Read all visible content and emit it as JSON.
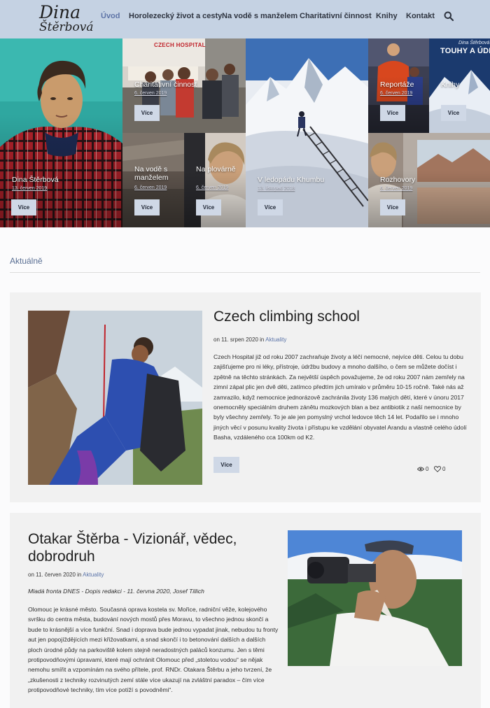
{
  "logo": {
    "line1": "Dina",
    "line2": "Štěrbová"
  },
  "nav": [
    {
      "label": "Úvod"
    },
    {
      "label": "Horolezecký život a cesty"
    },
    {
      "label": "Na vodě s manželem"
    },
    {
      "label": "Charitativní činnost"
    },
    {
      "label": "Knihy"
    },
    {
      "label": "Kontakt"
    }
  ],
  "tiles": [
    {
      "title": "Dina Štěrbová",
      "date": "13. červen 2019",
      "button": "Více"
    },
    {
      "title": "Charitativní činnost",
      "date": "6. červen 2019",
      "button": "Více"
    },
    {
      "title": "Na vodě s manželem",
      "date": "6. červen 2019",
      "button": "Více"
    },
    {
      "title": "Na plovárně",
      "date": "6. červen 2019",
      "button": "Více"
    },
    {
      "title": "V ledopádu Khumbu",
      "date": "13. listopad 2018",
      "button": "Více"
    },
    {
      "title": "Reportáže",
      "date": "6. červen 2019",
      "button": "Více"
    },
    {
      "title": "Knihy",
      "date": "",
      "button": "Více"
    },
    {
      "title": "Rozhovory",
      "date": "6. červen 2019",
      "button": "Více"
    }
  ],
  "book_cover": {
    "author": "Dina Štěrbová",
    "title": "TOUHY A ÚDĚL"
  },
  "hospital_sign": "CZECH HOSPITAL",
  "section_title": "Aktuálně",
  "posts": [
    {
      "title": "Czech climbing school",
      "meta_prefix": "on 11. srpen 2020 in",
      "category": "Aktuality",
      "text": "Czech Hospital již od roku 2007 zachraňuje životy a léčí nemocné, nejvíce děti. Celou tu dobu zajišťujeme pro ni léky, přístroje, údržbu budovy a mnoho dalšího, o čem se můžete dočíst i zpětně na těchto stránkách. Za největší úspěch považujeme, že od roku 2007 nám zemřely na zimní zápal plic jen dvě děti, zatímco předtím jich umíralo v průměru 10-15 ročně. Také nás až zamrazilo, když nemocnice jednorázově zachránila životy 136 malých dětí, které v únoru 2017 onemocněly speciálním druhem zánětu mozkových blan a bez antibiotik z naší nemocnice by byly všechny zemřely. To je ale jen pomyslný vrchol ledovce těch 14 let. Podařilo se i mnoho jiných věcí v posunu kvality života i přístupu ke vzdělání obyvatel Arandu a vlastně celého údolí Basha, vzdáleného cca 100km od K2.",
      "button": "Více",
      "views": "0",
      "likes": "0"
    },
    {
      "title": "Otakar Štěrba - Vizionář, vědec, dobrodruh",
      "meta_prefix": "on 11. červen 2020 in",
      "category": "Aktuality",
      "subtitle": "Mladá fronta DNES - Dopis redakci - 11. června 2020, Josef Tillich",
      "text": "Olomouc je krásné město. Současná oprava kostela sv. Mořice, radniční věže, kolejového svršku do centra města, budování nových mostů přes Moravu, to všechno jednou skončí a bude to krásnější a více funkční. Snad i doprava bude jednou vypadat jinak, nebudou tu fronty aut jen popojíždějících mezi křižovatkami, a snad skončí i to betonování dalších a dalších ploch úrodné půdy na parkoviště kolem stejně neradostných paláců konzumu. Jen s těmi protipovodňovými úpravami, které mají ochránit Olomouc před „stoletou vodou“ se nějak nemohu smířit a vzpomínám na svého přítele, prof. RNDr. Otakara Štěrbu a jeho tvrzení, že „zkušenosti z techniky rozvinutých zemí stále více ukazují na zvláštní paradox – čím více protipovodňové techniky, tím více potíží s povodněmi“."
    }
  ]
}
